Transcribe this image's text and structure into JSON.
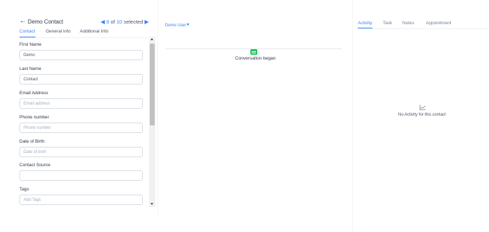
{
  "contact": {
    "back_icon": "arrow-left-icon",
    "name": "Demo Contact",
    "pager": {
      "current": "6",
      "of_label": "of",
      "total": "10",
      "selected_label": "selected"
    }
  },
  "left_tabs": [
    "Contact",
    "General Info",
    "Additional Info"
  ],
  "fields": [
    {
      "label": "First Name",
      "value": "Demo",
      "placeholder": ""
    },
    {
      "label": "Last Name",
      "value": "Contact",
      "placeholder": ""
    },
    {
      "label": "Email Address",
      "value": "",
      "placeholder": "Email address"
    },
    {
      "label": "Phone number",
      "value": "",
      "placeholder": "Phone number"
    },
    {
      "label": "Date of Birth",
      "value": "",
      "placeholder": "Date of birth"
    },
    {
      "label": "Contact Source",
      "value": "",
      "placeholder": ""
    },
    {
      "label": "Tags",
      "value": "",
      "placeholder": "Add Tags"
    }
  ],
  "conversation": {
    "user_selector": "Demo User",
    "event_icon": "chat-bubble-icon",
    "event_text": "Conversation began"
  },
  "right_tabs": [
    "Activity",
    "Task",
    "Notes",
    "Appointment"
  ],
  "activity": {
    "empty_icon": "line-chart-icon",
    "empty_text": "No Activity for this contact"
  },
  "colors": {
    "accent": "#3b82f6",
    "event_green": "#22c55e"
  }
}
